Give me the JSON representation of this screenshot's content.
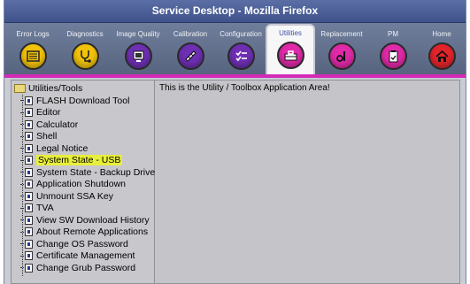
{
  "window": {
    "title": "Service Desktop - Mozilla Firefox"
  },
  "toolbar": {
    "tabs": [
      {
        "label": "Error Logs",
        "icon": "error-logs-icon",
        "color": "#f2c20b"
      },
      {
        "label": "Diagnostics",
        "icon": "stethoscope-icon",
        "color": "#f2c20b"
      },
      {
        "label": "Image Quality",
        "icon": "image-quality-icon",
        "color": "#6e2fb3"
      },
      {
        "label": "Calibration",
        "icon": "calibration-icon",
        "color": "#6e2fb3"
      },
      {
        "label": "Configuration",
        "icon": "configuration-icon",
        "color": "#6e2fb3"
      },
      {
        "label": "Utilities",
        "icon": "toolbox-icon",
        "color": "#e02aa9"
      },
      {
        "label": "Replacement",
        "icon": "replacement-icon",
        "color": "#e02aa9"
      },
      {
        "label": "PM",
        "icon": "pm-clipboard-icon",
        "color": "#e02aa9"
      },
      {
        "label": "Home",
        "icon": "home-icon",
        "color": "#e3242b"
      }
    ],
    "active_tab": "Utilities",
    "accent_color": "#d42bb7"
  },
  "sidebar": {
    "root": "Utilities/Tools",
    "items": [
      "FLASH Download Tool",
      "Editor",
      "Calculator",
      "Shell",
      "Legal Notice",
      "System State - USB",
      "System State - Backup Drive",
      "Application Shutdown",
      "Unmount SSA Key",
      "TVA",
      "View SW Download History",
      "About Remote Applications",
      "Change OS Password",
      "Certificate Management",
      "Change Grub Password"
    ],
    "selected": "System State - USB",
    "highlight_color": "#e8ef3a"
  },
  "main": {
    "message": "This is the Utility / Toolbox Application Area!"
  }
}
